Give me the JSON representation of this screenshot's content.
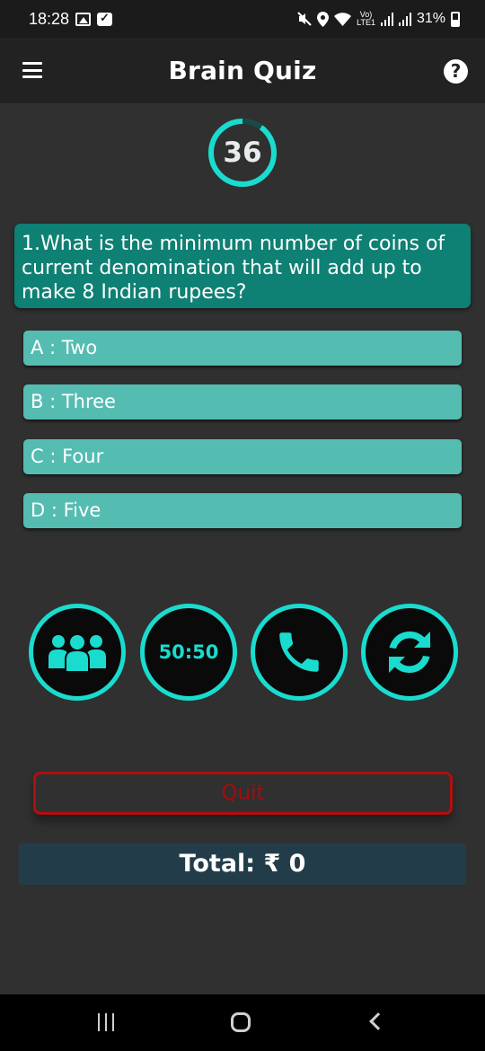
{
  "status_bar": {
    "time": "18:28",
    "network_label_top": "Vo)",
    "network_label_bottom": "LTE1",
    "battery": "31%"
  },
  "app_bar": {
    "title": "Brain Quiz",
    "menu_icon": "hamburger-menu-icon",
    "help_icon": "help-circle-icon",
    "help_glyph": "?"
  },
  "timer": {
    "value": "36",
    "progress_fraction": 0.9,
    "ring_color": "#19dccf"
  },
  "question": {
    "text": "1.What is the minimum number of coins of current denomination that will add up to make 8 Indian rupees?"
  },
  "options": [
    {
      "label": "A : Two"
    },
    {
      "label": "B : Three"
    },
    {
      "label": "C : Four"
    },
    {
      "label": "D : Five"
    }
  ],
  "lifelines": [
    {
      "name": "audience-poll",
      "icon": "people-group-icon"
    },
    {
      "name": "fifty-fifty",
      "label": "50:50"
    },
    {
      "name": "phone-a-friend",
      "icon": "phone-icon"
    },
    {
      "name": "swap-question",
      "icon": "swap-arrows-icon"
    }
  ],
  "quit_label": "Quit",
  "total_label": "Total: ₹ 0",
  "colors": {
    "accent": "#19dccf",
    "question_bg": "#0f8074",
    "option_bg": "#55bcb2",
    "quit": "#b20e0e",
    "total_bg": "#223d49"
  }
}
